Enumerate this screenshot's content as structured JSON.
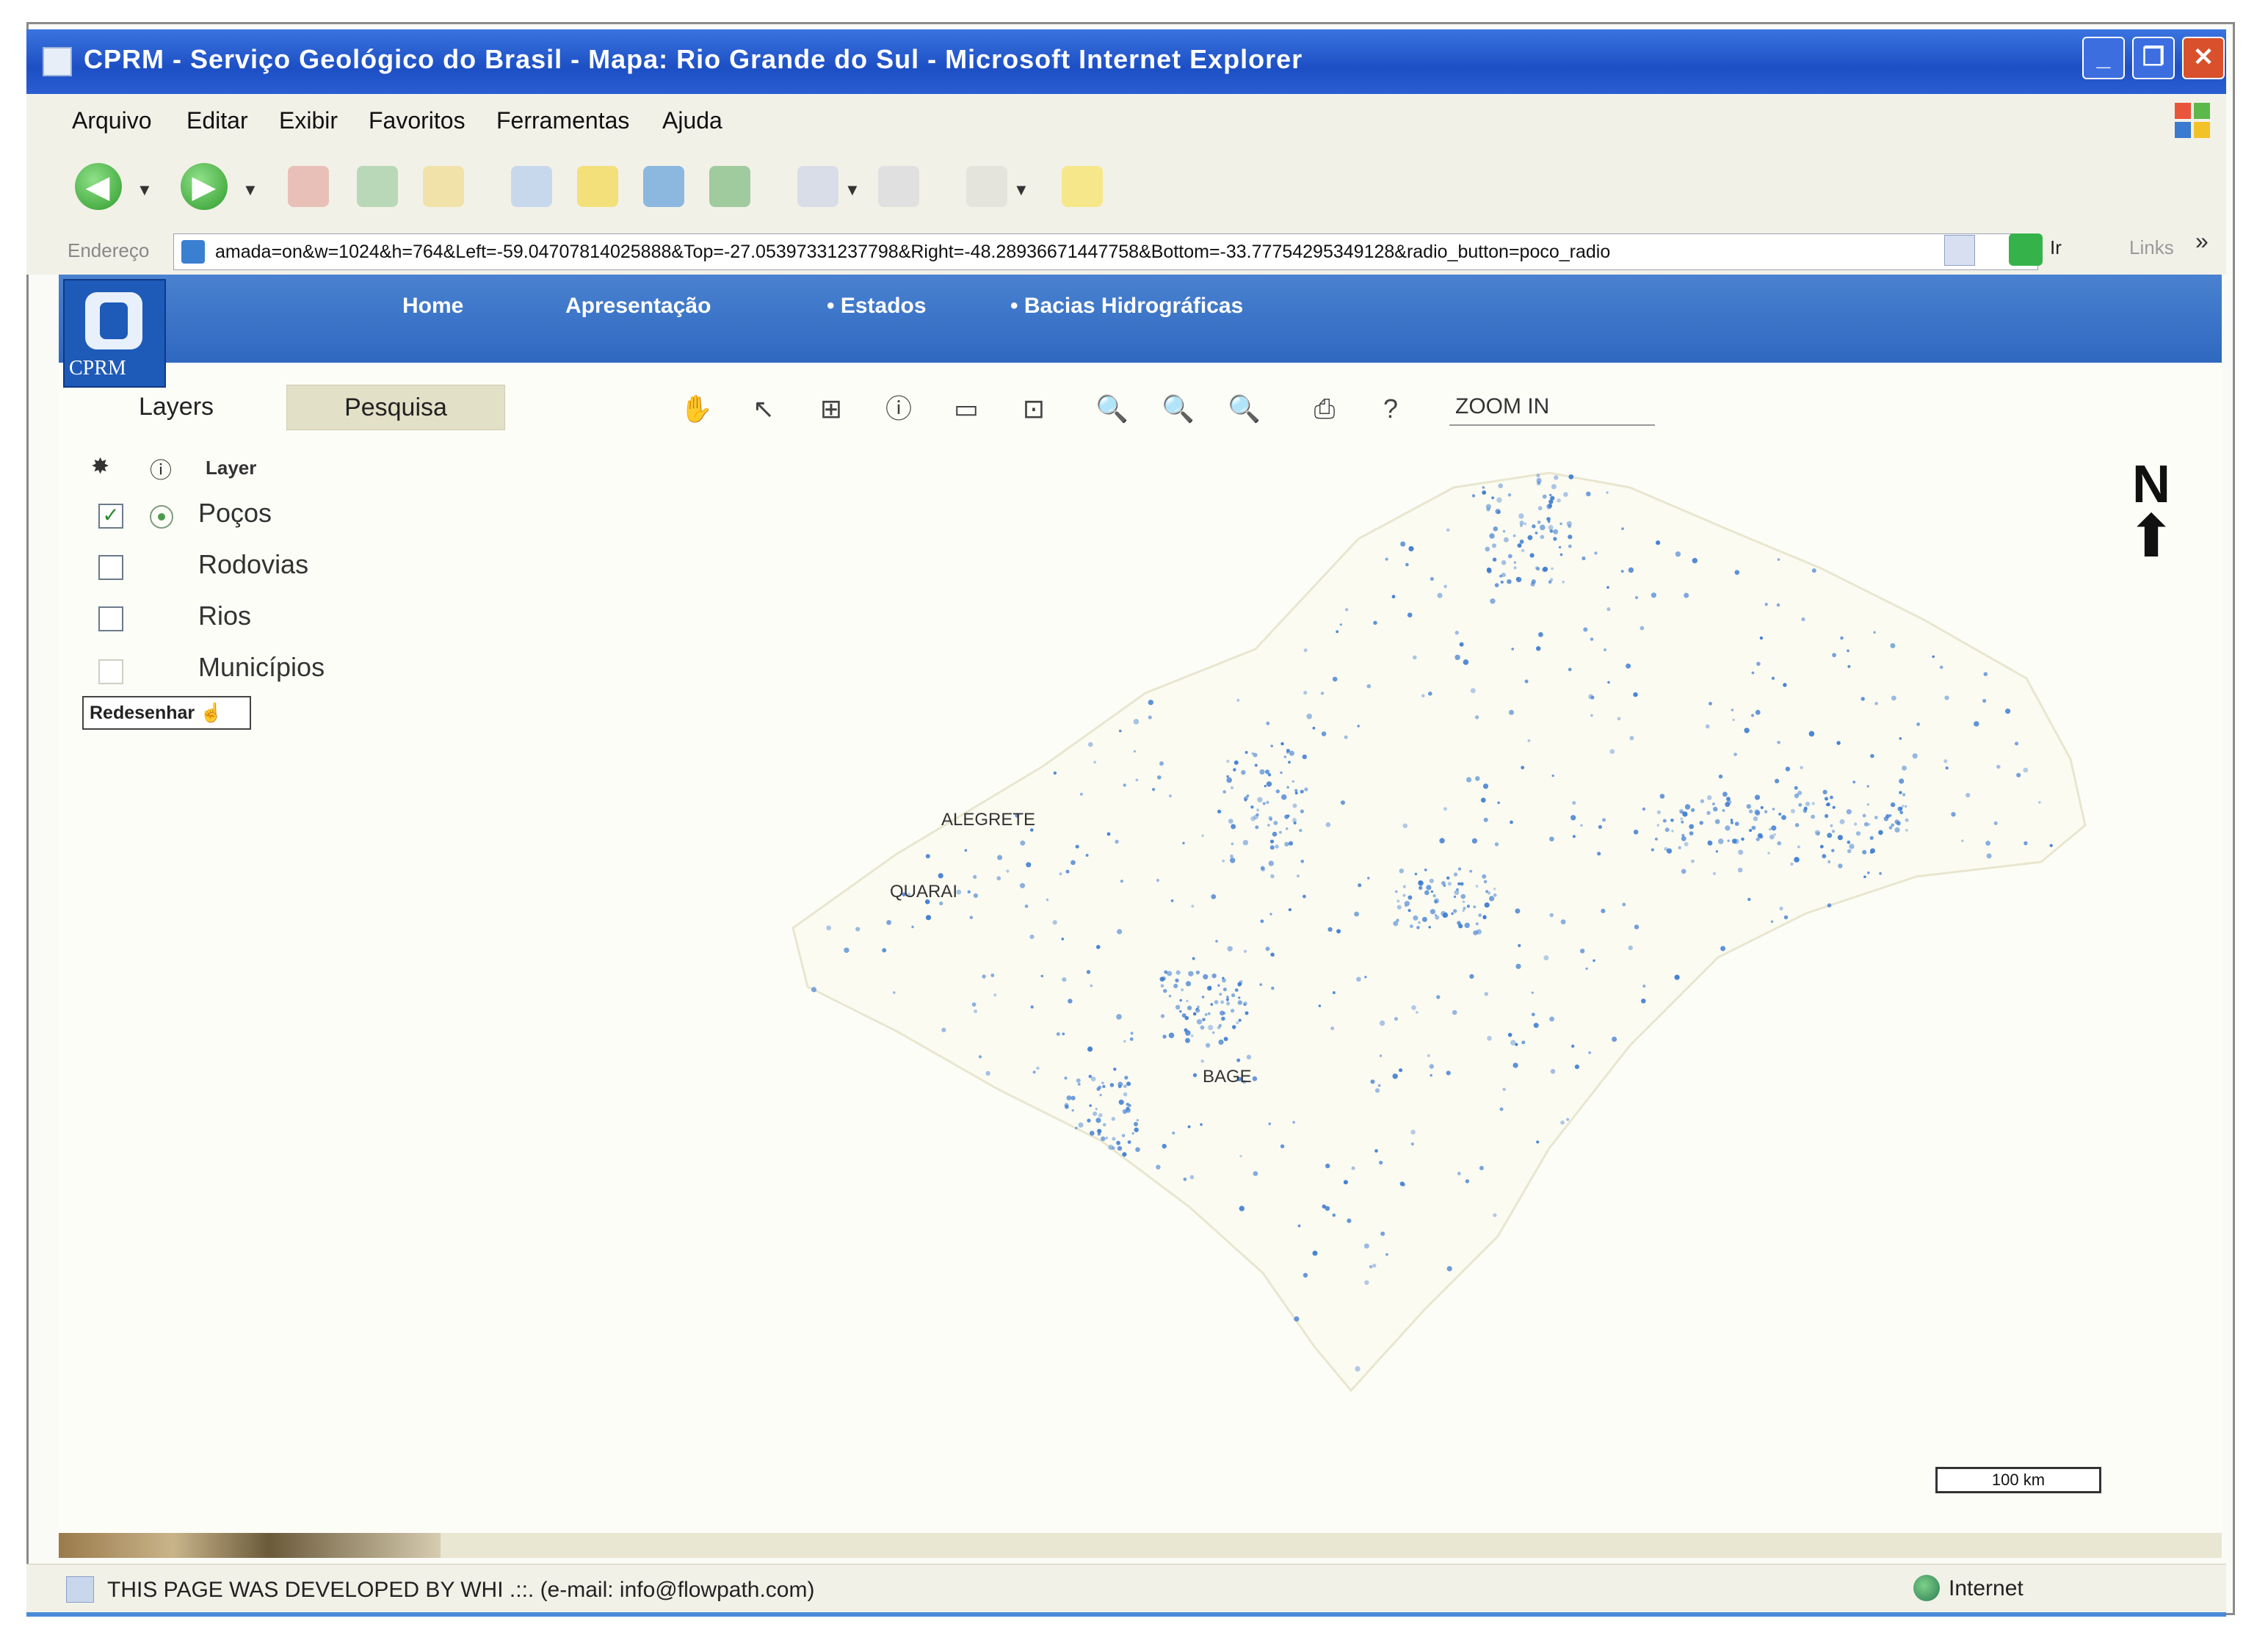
{
  "window": {
    "title": "CPRM - Serviço Geológico do Brasil - Mapa: Rio Grande do Sul - Microsoft Internet Explorer"
  },
  "menu": {
    "items": [
      "Arquivo",
      "Editar",
      "Exibir",
      "Favoritos",
      "Ferramentas",
      "Ajuda"
    ]
  },
  "address": {
    "label": "Endereço",
    "url": "amada=on&w=1024&h=764&Left=-59.04707814025888&Top=-27.05397331237798&Right=-48.28936671447758&Bottom=-33.77754295349128&radio_button=poco_radio",
    "go_label": "Ir",
    "links_label": "Links"
  },
  "site": {
    "logo_text": "CPRM",
    "nav": [
      "Home",
      "Apresentação",
      "• Estados",
      "• Bacias Hidrográficas"
    ]
  },
  "sidebar": {
    "tabs": [
      "Layers",
      "Pesquisa"
    ],
    "layer_header": "Layer",
    "layers": [
      {
        "label": "Poços",
        "checked": true
      },
      {
        "label": "Rodovias",
        "checked": false
      },
      {
        "label": "Rios",
        "checked": false
      },
      {
        "label": "Municípios",
        "checked": false
      }
    ],
    "redraw_label": "Redesenhar"
  },
  "map": {
    "zoom_mode": "ZOOM IN",
    "north_label": "N",
    "scale_label": "100 km",
    "city_labels": [
      "ALEGRETE",
      "QUARAI",
      "BAGE"
    ],
    "point_color": "#3a7ad0"
  },
  "status": {
    "text": "THIS PAGE WAS DEVELOPED BY WHI  .::.  (e-mail: info@flowpath.com)",
    "zone": "Internet"
  }
}
